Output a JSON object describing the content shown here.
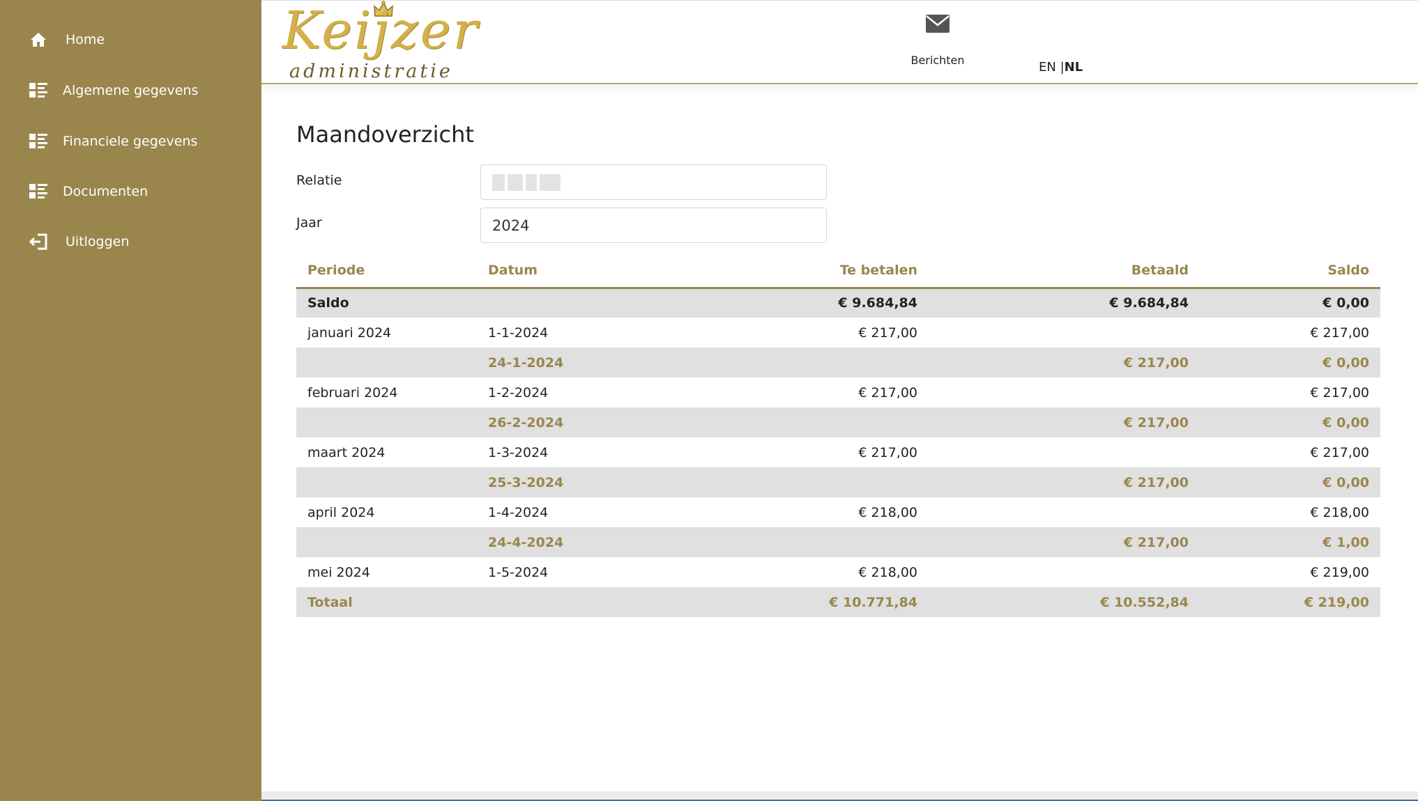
{
  "sidebar": {
    "items": [
      {
        "label": "Home",
        "icon": "home-icon"
      },
      {
        "label": "Algemene gegevens",
        "icon": "list-icon"
      },
      {
        "label": "Financiele gegevens",
        "icon": "list-icon"
      },
      {
        "label": "Documenten",
        "icon": "list-icon"
      },
      {
        "label": "Uitloggen",
        "icon": "logout-icon"
      }
    ]
  },
  "header": {
    "logo_main": "Keijzer",
    "logo_sub": "administratie",
    "messages_label": "Berichten",
    "lang_en": "EN",
    "lang_sep": " |",
    "lang_nl": "NL"
  },
  "page": {
    "title": "Maandoverzicht",
    "relatie_label": "Relatie",
    "jaar_label": "Jaar",
    "jaar_value": "2024"
  },
  "table": {
    "headers": [
      "Periode",
      "Datum",
      "Te betalen",
      "Betaald",
      "Saldo"
    ],
    "rows": [
      {
        "type": "saldo",
        "cells": [
          "Saldo",
          "",
          "€ 9.684,84",
          "€ 9.684,84",
          "€ 0,00"
        ]
      },
      {
        "type": "month",
        "cells": [
          "januari 2024",
          "1-1-2024",
          "€ 217,00",
          "",
          "€ 217,00"
        ]
      },
      {
        "type": "pay",
        "cells": [
          "",
          "24-1-2024",
          "",
          "€ 217,00",
          "€ 0,00"
        ]
      },
      {
        "type": "month",
        "cells": [
          "februari 2024",
          "1-2-2024",
          "€ 217,00",
          "",
          "€ 217,00"
        ]
      },
      {
        "type": "pay",
        "cells": [
          "",
          "26-2-2024",
          "",
          "€ 217,00",
          "€ 0,00"
        ]
      },
      {
        "type": "month",
        "cells": [
          "maart 2024",
          "1-3-2024",
          "€ 217,00",
          "",
          "€ 217,00"
        ]
      },
      {
        "type": "pay",
        "cells": [
          "",
          "25-3-2024",
          "",
          "€ 217,00",
          "€ 0,00"
        ]
      },
      {
        "type": "month",
        "cells": [
          "april 2024",
          "1-4-2024",
          "€ 218,00",
          "",
          "€ 218,00"
        ]
      },
      {
        "type": "pay",
        "cells": [
          "",
          "24-4-2024",
          "",
          "€ 217,00",
          "€ 1,00"
        ]
      },
      {
        "type": "month",
        "cells": [
          "mei 2024",
          "1-5-2024",
          "€ 218,00",
          "",
          "€ 219,00"
        ]
      },
      {
        "type": "total",
        "cells": [
          "Totaal",
          "",
          "€ 10.771,84",
          "€ 10.552,84",
          "€ 219,00"
        ]
      }
    ]
  },
  "colors": {
    "sidebar": "#9a864d",
    "accent": "#9a864d",
    "row_shade": "#e0e0e0"
  }
}
